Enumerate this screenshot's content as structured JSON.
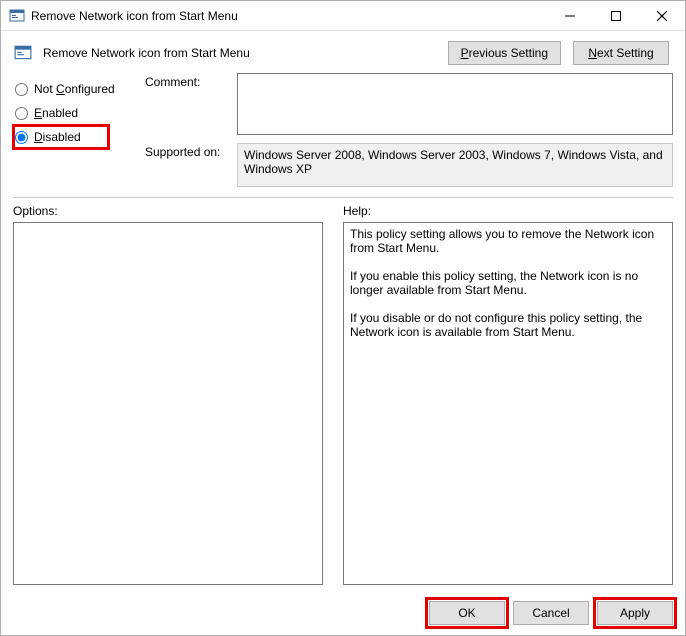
{
  "titlebar": {
    "title": "Remove Network icon from Start Menu"
  },
  "header": {
    "heading": "Remove Network icon from Start Menu",
    "previous_setting_label": "Previous Setting",
    "next_setting_label": "Next Setting"
  },
  "state": {
    "options": {
      "not_configured": {
        "label": "Not Configured",
        "underline": "C"
      },
      "enabled": {
        "label": "Enabled",
        "underline": "E"
      },
      "disabled": {
        "label": "Disabled",
        "underline": "D"
      }
    },
    "selected": "disabled"
  },
  "fields": {
    "comment_label": "Comment:",
    "comment_value": "",
    "supported_label": "Supported on:",
    "supported_value": "Windows Server 2008, Windows Server 2003, Windows 7, Windows Vista, and Windows XP"
  },
  "lower": {
    "options_label": "Options:",
    "options_content": "",
    "help_label": "Help:",
    "help_content": "This policy setting allows you to remove the Network icon from Start Menu.\n\nIf you enable this policy setting, the Network icon is no longer available from Start Menu.\n\nIf you disable or do not configure this policy setting, the Network icon is available from Start Menu."
  },
  "footer": {
    "ok_label": "OK",
    "cancel_label": "Cancel",
    "apply_label": "Apply"
  }
}
